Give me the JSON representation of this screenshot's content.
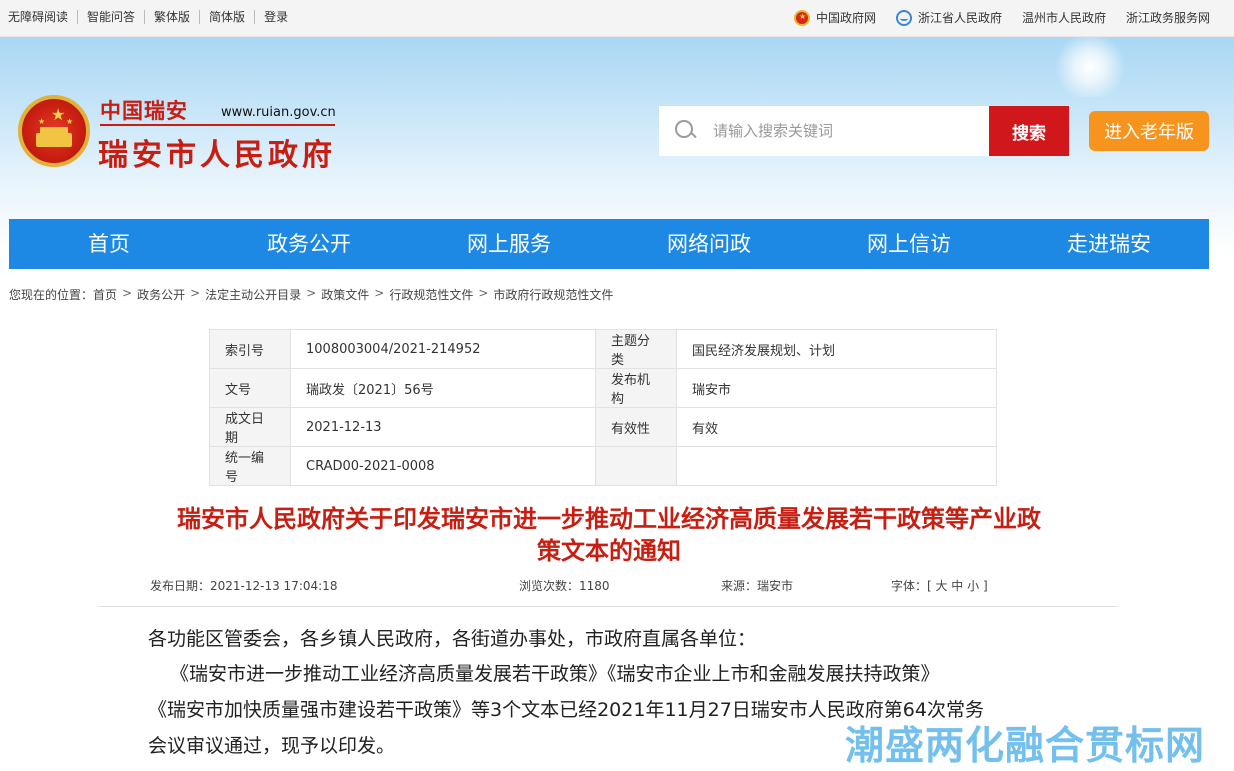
{
  "topbar": {
    "left_links": [
      "无障碍阅读",
      "智能问答",
      "繁体版",
      "简体版",
      "登录"
    ],
    "right_links": [
      {
        "label": "中国政府网",
        "icon": "national-emblem-icon"
      },
      {
        "label": "浙江省人民政府",
        "icon": "zhejiang-logo-icon"
      },
      {
        "label": "温州市人民政府",
        "icon": ""
      },
      {
        "label": "浙江政务服务网",
        "icon": ""
      }
    ]
  },
  "header": {
    "logo_small": "中国瑞安",
    "logo_url": "www.ruian.gov.cn",
    "logo_big": "瑞安市人民政府",
    "search_placeholder": "请输入搜索关键词",
    "search_button": "搜索",
    "elder_button": "进入老年版"
  },
  "nav": [
    "首页",
    "政务公开",
    "网上服务",
    "网络问政",
    "网上信访",
    "走进瑞安"
  ],
  "breadcrumb": {
    "prefix": "您现在的位置：",
    "items": [
      "首页",
      "政务公开",
      "法定主动公开目录",
      "政策文件",
      "行政规范性文件",
      "市政府行政规范性文件"
    ]
  },
  "info_table": [
    {
      "k1": "索引号",
      "v1": "1008003004/2021-214952",
      "k2": "主题分类",
      "v2": "国民经济发展规划、计划"
    },
    {
      "k1": "文号",
      "v1": "瑞政发〔2021〕56号",
      "k2": "发布机构",
      "v2": "瑞安市"
    },
    {
      "k1": "成文日期",
      "v1": "2021-12-13",
      "k2": "有效性",
      "v2": "有效"
    },
    {
      "k1": "统一编号",
      "v1": "CRAD00-2021-0008",
      "k2": "",
      "v2": ""
    }
  ],
  "article": {
    "title_line1": "瑞安市人民政府关于印发瑞安市进一步推动工业经济高质量发展若干政策等产业政",
    "title_line2": "策文本的通知",
    "publish_date": "发布日期：2021-12-13 17:04:18",
    "views": "浏览次数：1180",
    "source": "来源：瑞安市",
    "font_size": "字体：[ 大 中 小 ]",
    "paragraphs": [
      "各功能区管委会，各乡镇人民政府，各街道办事处，市政府直属各单位：",
      "《瑞安市进一步推动工业经济高质量发展若干政策》《瑞安市企业上市和金融发展扶持政策》",
      "《瑞安市加快质量强市建设若干政策》等3个文本已经2021年11月27日瑞安市人民政府第64次常务",
      "会议审议通过，现予以印发。"
    ]
  },
  "watermark": "潮盛两化融合贯标网"
}
